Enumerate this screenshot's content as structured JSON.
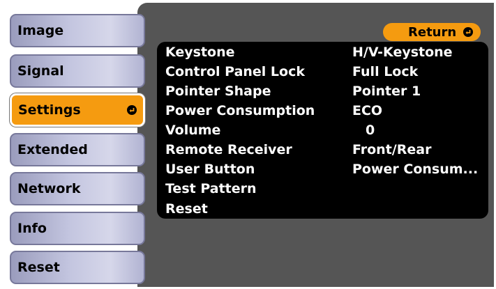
{
  "sidebar": {
    "items": [
      {
        "label": "Image"
      },
      {
        "label": "Signal"
      },
      {
        "label": "Settings"
      },
      {
        "label": "Extended"
      },
      {
        "label": "Network"
      },
      {
        "label": "Info"
      },
      {
        "label": "Reset"
      }
    ]
  },
  "header": {
    "return_label": "Return"
  },
  "settings": {
    "rows": [
      {
        "label": "Keystone",
        "value": "H/V-Keystone"
      },
      {
        "label": "Control Panel Lock",
        "value": "Full Lock"
      },
      {
        "label": "Pointer Shape",
        "value": "Pointer 1"
      },
      {
        "label": "Power Consumption",
        "value": "ECO"
      },
      {
        "label": "Volume",
        "value": "0"
      },
      {
        "label": "Remote Receiver",
        "value": "Front/Rear"
      },
      {
        "label": "User Button",
        "value": "Power Consum..."
      },
      {
        "label": "Test Pattern",
        "value": ""
      },
      {
        "label": "Reset",
        "value": ""
      }
    ]
  },
  "colors": {
    "accent": "#f59b10",
    "menu_background": "#555555",
    "panel_background": "#000000"
  }
}
